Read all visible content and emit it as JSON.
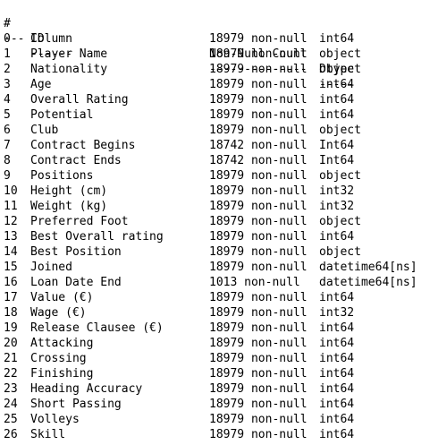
{
  "header": {
    "idx": "#",
    "column": "Column",
    "count": "Non-Null Count",
    "dtype": "Dtype"
  },
  "separator": {
    "idx": "---",
    "column": "------",
    "count": "--------------",
    "dtype": "-----"
  },
  "rows": [
    {
      "idx": "0",
      "column": "ID",
      "count": "18979 non-null",
      "dtype": "int64"
    },
    {
      "idx": "1",
      "column": "Player Name",
      "count": "18979 non-null",
      "dtype": "object"
    },
    {
      "idx": "2",
      "column": "Nationality",
      "count": "18979 non-null",
      "dtype": "object"
    },
    {
      "idx": "3",
      "column": "Age",
      "count": "18979 non-null",
      "dtype": "int64"
    },
    {
      "idx": "4",
      "column": "Overall Rating",
      "count": "18979 non-null",
      "dtype": "int64"
    },
    {
      "idx": "5",
      "column": "Potential",
      "count": "18979 non-null",
      "dtype": "int64"
    },
    {
      "idx": "6",
      "column": "Club",
      "count": "18979 non-null",
      "dtype": "object"
    },
    {
      "idx": "7",
      "column": "Contract Begins",
      "count": "18742 non-null",
      "dtype": "Int64"
    },
    {
      "idx": "8",
      "column": "Contract Ends",
      "count": "18742 non-null",
      "dtype": "Int64"
    },
    {
      "idx": "9",
      "column": "Positions",
      "count": "18979 non-null",
      "dtype": "object"
    },
    {
      "idx": "10",
      "column": "Height (cm)",
      "count": "18979 non-null",
      "dtype": "int32"
    },
    {
      "idx": "11",
      "column": "Weight (kg)",
      "count": "18979 non-null",
      "dtype": "int32"
    },
    {
      "idx": "12",
      "column": "Preferred Foot",
      "count": "18979 non-null",
      "dtype": "object"
    },
    {
      "idx": "13",
      "column": "Best Overall rating",
      "count": "18979 non-null",
      "dtype": "int64"
    },
    {
      "idx": "14",
      "column": "Best Position",
      "count": "18979 non-null",
      "dtype": "object"
    },
    {
      "idx": "15",
      "column": "Joined",
      "count": "18979 non-null",
      "dtype": "datetime64[ns]"
    },
    {
      "idx": "16",
      "column": "Loan Date End",
      "count": "1013 non-null",
      "dtype": "datetime64[ns]"
    },
    {
      "idx": "17",
      "column": "Value (€)",
      "count": "18979 non-null",
      "dtype": "int64"
    },
    {
      "idx": "18",
      "column": "Wage (€)",
      "count": "18979 non-null",
      "dtype": "int32"
    },
    {
      "idx": "19",
      "column": "Release Clausee (€)",
      "count": "18979 non-null",
      "dtype": "int64"
    },
    {
      "idx": "20",
      "column": "Attacking",
      "count": "18979 non-null",
      "dtype": "int64"
    },
    {
      "idx": "21",
      "column": "Crossing",
      "count": "18979 non-null",
      "dtype": "int64"
    },
    {
      "idx": "22",
      "column": "Finishing",
      "count": "18979 non-null",
      "dtype": "int64"
    },
    {
      "idx": "23",
      "column": "Heading Accuracy",
      "count": "18979 non-null",
      "dtype": "int64"
    },
    {
      "idx": "24",
      "column": "Short Passing",
      "count": "18979 non-null",
      "dtype": "int64"
    },
    {
      "idx": "25",
      "column": "Volleys",
      "count": "18979 non-null",
      "dtype": "int64"
    },
    {
      "idx": "26",
      "column": "Skill",
      "count": "18979 non-null",
      "dtype": "int64"
    }
  ]
}
